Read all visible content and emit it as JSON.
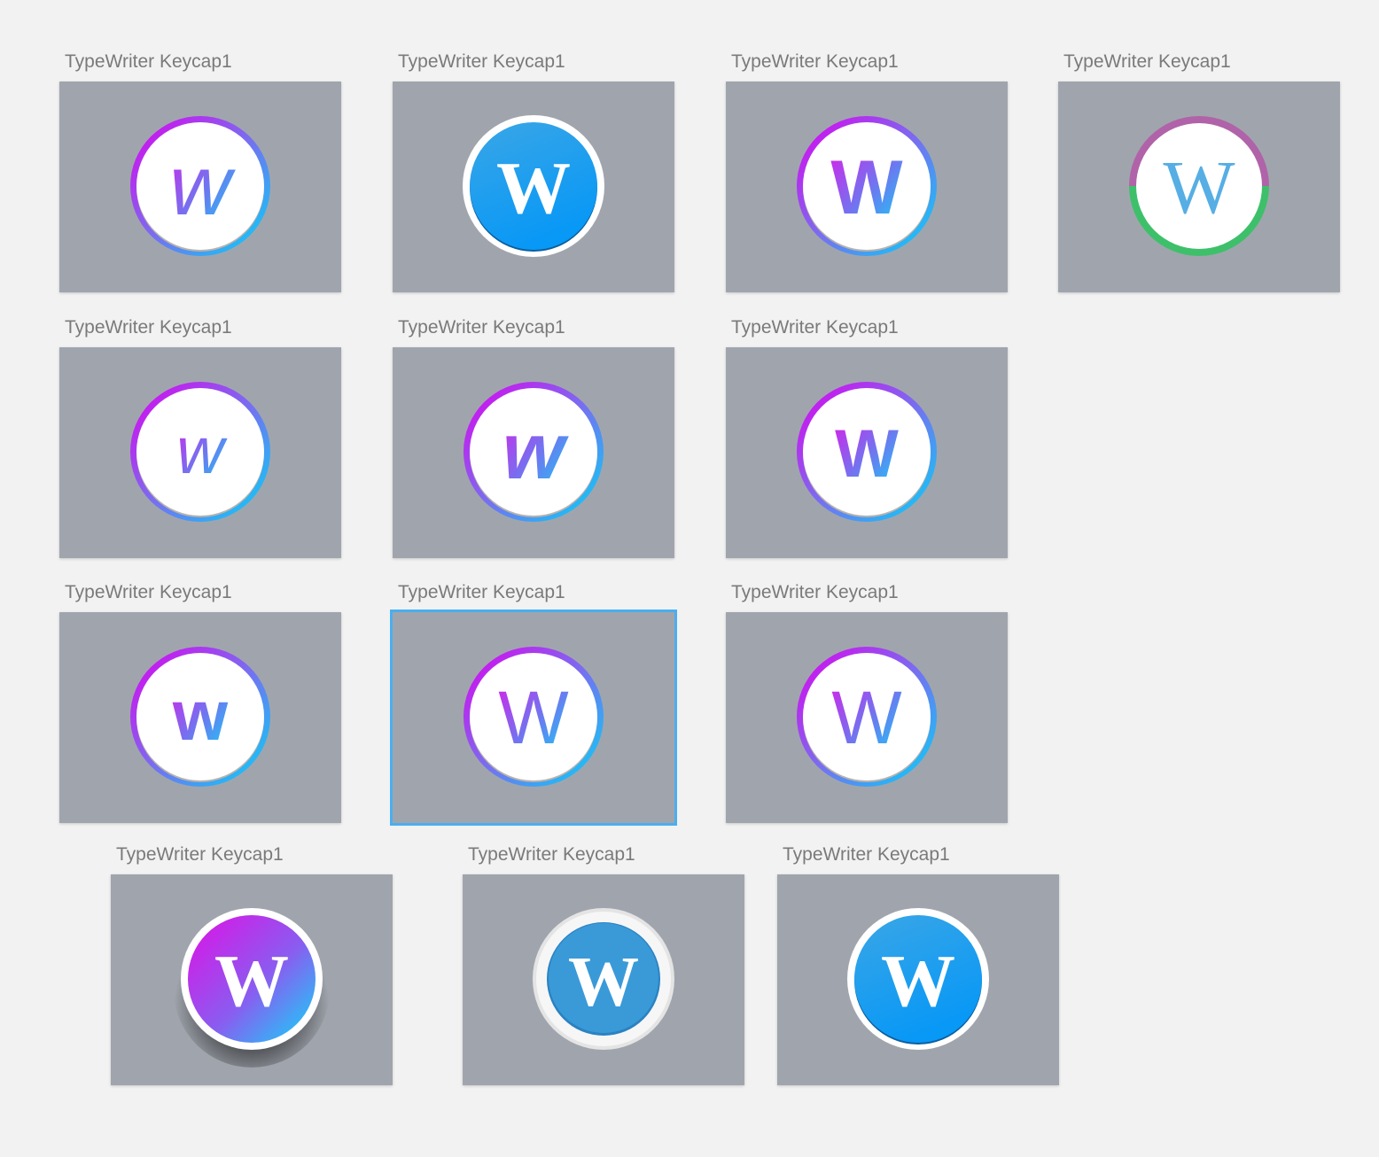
{
  "canvas": {
    "background": "#f2f2f2",
    "artboard_color": "#a0a5ad",
    "selection_color": "#4aaef0"
  },
  "artboards": [
    {
      "label": "TypeWriter Keycap1",
      "glyph": "W",
      "style": "script",
      "selected": false
    },
    {
      "label": "TypeWriter Keycap1",
      "glyph": "W",
      "style": "blue-fill",
      "selected": false
    },
    {
      "label": "TypeWriter Keycap1",
      "glyph": "W",
      "style": "bold-gradient",
      "selected": false
    },
    {
      "label": "TypeWriter Keycap1",
      "glyph": "W",
      "style": "split-ring",
      "selected": false
    },
    {
      "label": "TypeWriter Keycap1",
      "glyph": "W",
      "style": "brush",
      "selected": false
    },
    {
      "label": "TypeWriter Keycap1",
      "glyph": "W",
      "style": "brush-bold",
      "selected": false
    },
    {
      "label": "TypeWriter Keycap1",
      "glyph": "W",
      "style": "rounded",
      "selected": false
    },
    {
      "label": "TypeWriter Keycap1",
      "glyph": "W",
      "style": "slab",
      "selected": false
    },
    {
      "label": "TypeWriter Keycap1",
      "glyph": "W",
      "style": "serif-thin",
      "selected": true
    },
    {
      "label": "TypeWriter Keycap1",
      "glyph": "W",
      "style": "sans-thin",
      "selected": false
    },
    {
      "label": "TypeWriter Keycap1",
      "glyph": "W",
      "style": "magenta-fill",
      "selected": false
    },
    {
      "label": "TypeWriter Keycap1",
      "glyph": "W",
      "style": "blue-pearl",
      "selected": false
    },
    {
      "label": "TypeWriter Keycap1",
      "glyph": "W",
      "style": "blue-fill",
      "selected": false
    }
  ]
}
